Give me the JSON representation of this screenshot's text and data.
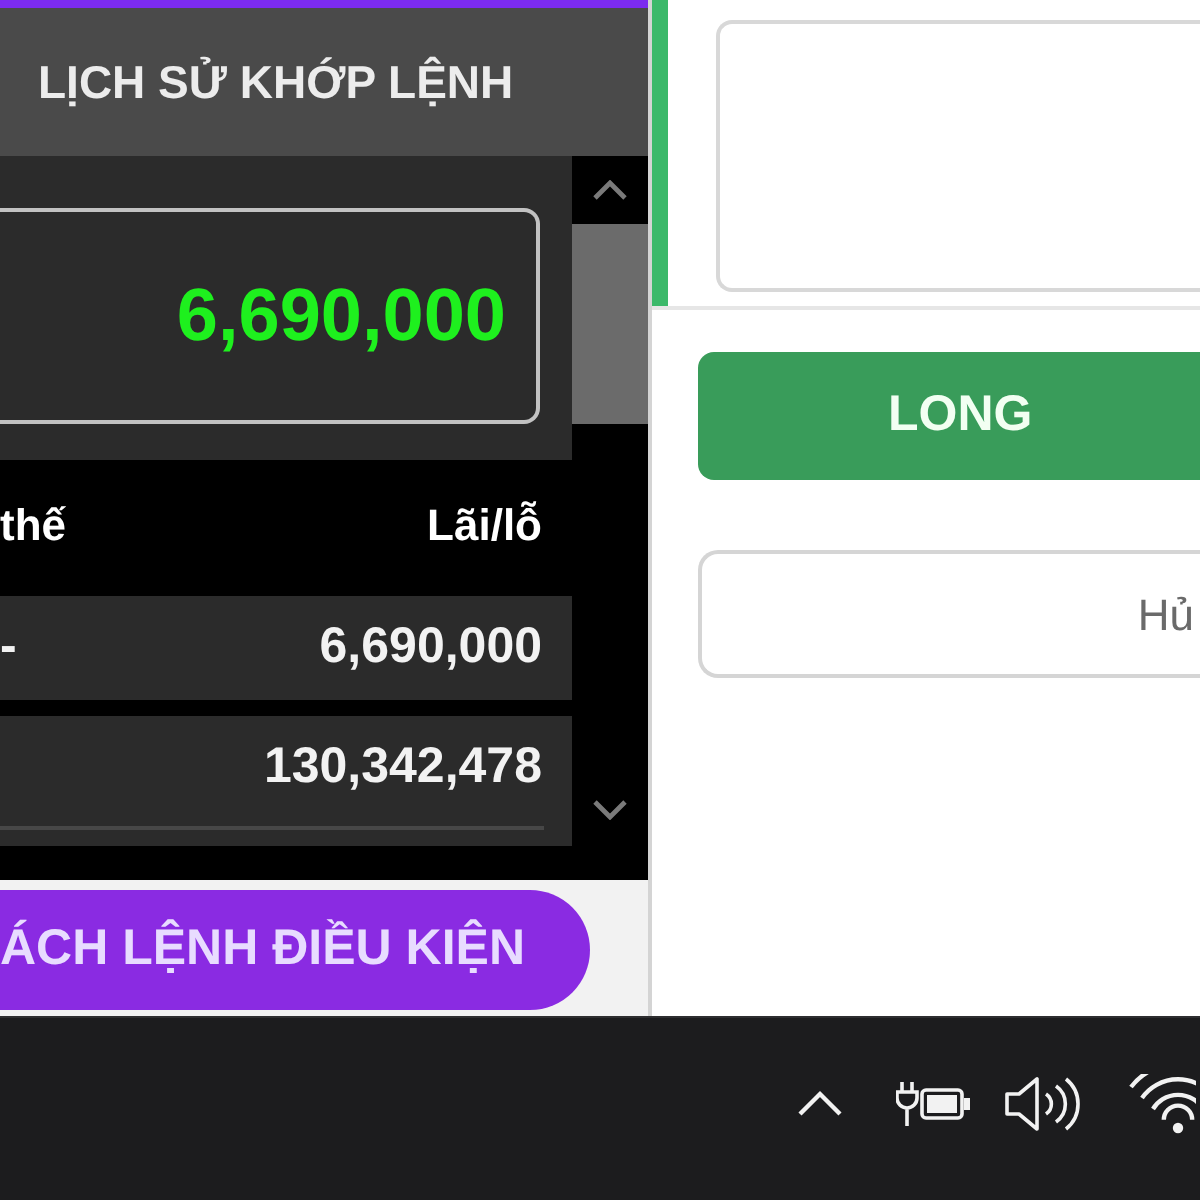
{
  "left_panel": {
    "tab": {
      "label": "LỊCH SỬ KHỚP LỆNH"
    },
    "summary": {
      "value": "6,690,000"
    },
    "table": {
      "columns": [
        "thế",
        "Lãi/lỗ"
      ],
      "rows": [
        {
          "column_1": "-",
          "column_2": "6,690,000"
        },
        {
          "column_2": "130,342,478"
        }
      ]
    },
    "conditional_orders_button": {
      "label": "ÁCH LỆNH ĐIỀU KIỆN"
    }
  },
  "order_panel": {
    "long_button": {
      "label": "LONG"
    },
    "cancel_button": {
      "label": "Hủ"
    }
  }
}
